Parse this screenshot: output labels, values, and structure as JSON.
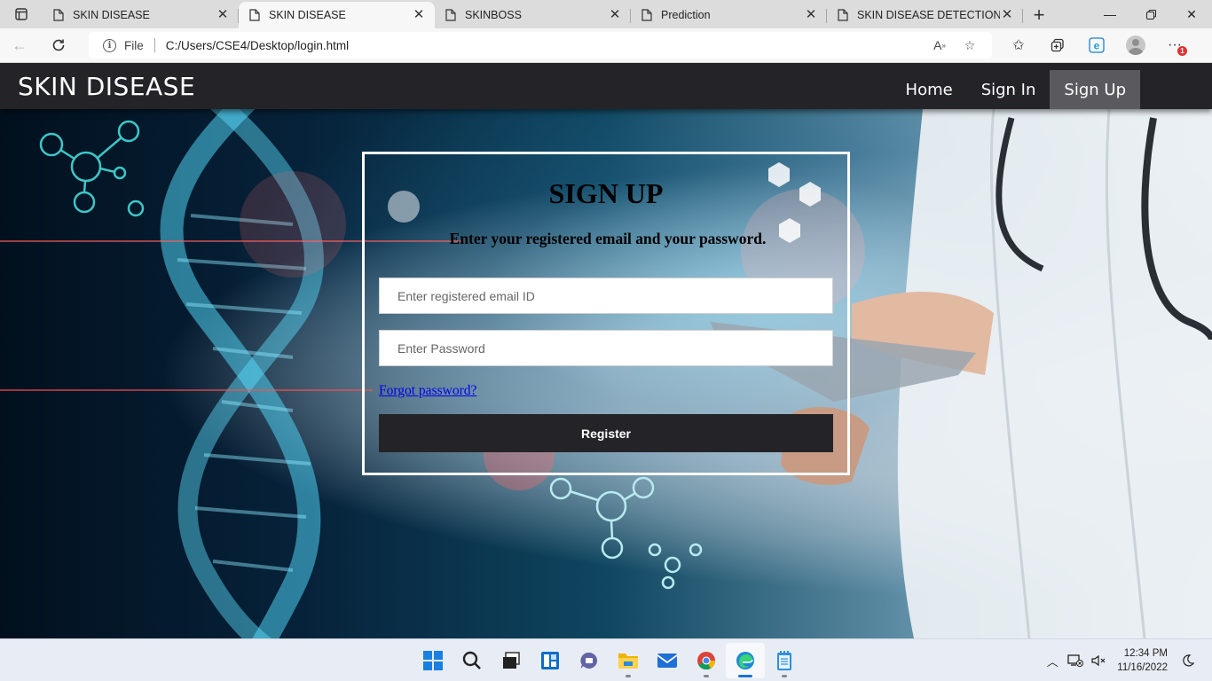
{
  "browser": {
    "tabs": [
      {
        "title": "SKIN DISEASE",
        "active": false
      },
      {
        "title": "SKIN DISEASE",
        "active": true
      },
      {
        "title": "SKINBOSS",
        "active": false
      },
      {
        "title": "Prediction",
        "active": false
      },
      {
        "title": "SKIN DISEASE DETECTION",
        "active": false
      }
    ],
    "address": {
      "scheme_label": "File",
      "url": "C:/Users/CSE4/Desktop/login.html"
    },
    "notification_count": "1"
  },
  "site": {
    "brand": "SKIN DISEASE",
    "nav": {
      "home": "Home",
      "sign_in": "Sign In",
      "sign_up": "Sign Up"
    }
  },
  "form": {
    "title": "SIGN UP",
    "subtitle": "Enter your registered email and your password.",
    "email_placeholder": "Enter registered email ID",
    "password_placeholder": "Enter Password",
    "forgot_link": "Forgot password?",
    "submit_label": "Register"
  },
  "taskbar": {
    "time": "12:34 PM",
    "date": "11/16/2022",
    "apps": [
      "windows-start-icon",
      "search-icon",
      "task-view-icon",
      "widgets-icon",
      "teams-chat-icon",
      "file-explorer-icon",
      "mail-icon",
      "chrome-icon",
      "edge-icon",
      "notepad-icon"
    ]
  },
  "colors": {
    "nav_bg": "#242428",
    "nav_active": "#5a5a5e",
    "button_bg": "#242428",
    "link": "#0000ee"
  }
}
